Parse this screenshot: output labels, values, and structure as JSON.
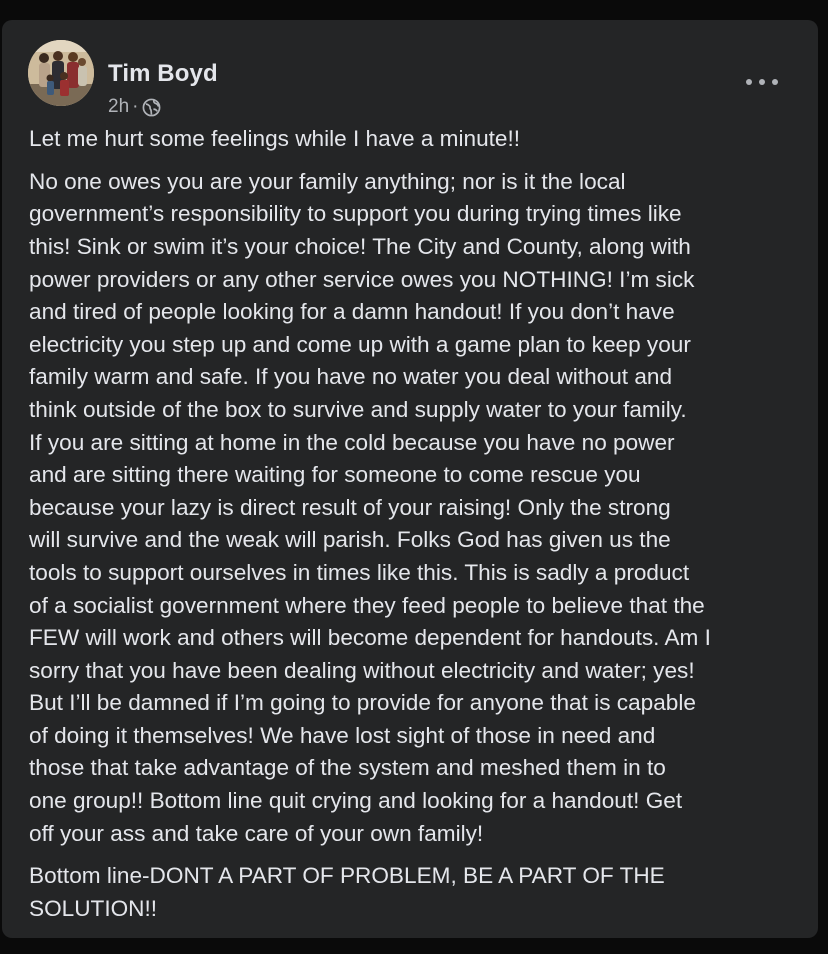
{
  "post": {
    "author": "Tim Boyd",
    "timestamp": "2h",
    "separator": "·",
    "privacy_icon": "globe-icon",
    "menu_icon": "more-horizontal-icon",
    "paragraphs": [
      "Let me hurt some feelings while I have a minute!!",
      "No one owes you are your family anything; nor is it the local\ngovernment’s responsibility to support you during trying times like\nthis! Sink or swim it’s your choice!  The City and County, along with\npower providers or any other service owes you NOTHING!  I’m sick\nand tired of people looking for a damn handout!  If you don’t have\nelectricity you step up and come up with a game plan to keep your\nfamily warm and safe. If you have no water you deal without and\nthink outside of the box to survive and supply water to your family.\nIf you are sitting at home in the cold because you have no power\nand are sitting there waiting for someone to come rescue you\nbecause your lazy is direct result of your raising!  Only the strong\nwill survive and the weak will parish. Folks God has given us the\ntools to support ourselves in times like this. This is sadly a product\nof a socialist government where they feed people to believe that the\nFEW will work and others will become dependent for handouts. Am I\nsorry that you have been dealing without electricity and water; yes!\nBut I’ll be damned if I’m going to provide for anyone that is capable\nof doing it themselves!  We have lost sight of those in need and\nthose that take advantage of the system and meshed them in to\none group!! Bottom line quit crying and looking for a handout! Get\noff your ass and take care of your own family!",
      "Bottom line-DONT A PART OF PROBLEM, BE A PART OF THE\nSOLUTION!!"
    ]
  },
  "colors": {
    "card_background": "#242526",
    "primary_text": "#e4e6eb",
    "secondary_text": "#b0b3b8"
  }
}
